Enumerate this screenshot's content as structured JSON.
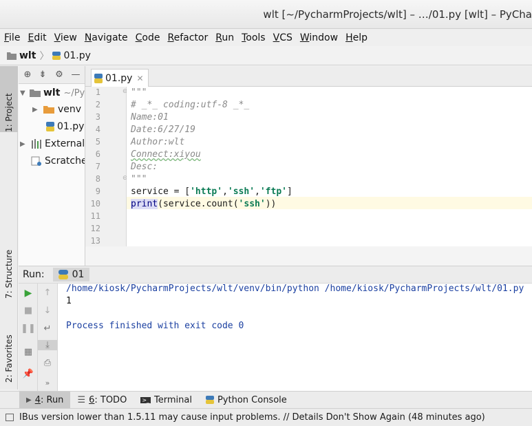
{
  "window": {
    "title": "wlt [~/PycharmProjects/wlt] – …/01.py [wlt] – PyCha"
  },
  "menu": [
    {
      "u": "F",
      "rest": "ile"
    },
    {
      "u": "E",
      "rest": "dit"
    },
    {
      "u": "V",
      "rest": "iew"
    },
    {
      "u": "N",
      "rest": "avigate"
    },
    {
      "u": "C",
      "rest": "ode"
    },
    {
      "u": "R",
      "rest": "efactor"
    },
    {
      "u": "R",
      "rest": "un"
    },
    {
      "u": "T",
      "rest": "ools"
    },
    {
      "u": "V",
      "rest": "CS"
    },
    {
      "u": "W",
      "rest": "indow"
    },
    {
      "u": "H",
      "rest": "elp"
    }
  ],
  "breadcrumb": {
    "project": "wlt",
    "file": "01.py"
  },
  "side_tabs": {
    "project": "1: Project",
    "structure": "7: Structure",
    "favorites": "2: Favorites"
  },
  "project_tree": {
    "root_name": "wlt",
    "root_path": "~/Py",
    "venv": "venv",
    "file": "01.py",
    "external": "External",
    "scratches": "Scratche"
  },
  "editor": {
    "tab_label": "01.py",
    "line_numbers": [
      "1",
      "2",
      "3",
      "4",
      "5",
      "6",
      "7",
      "8",
      "9",
      "10",
      "11",
      "12",
      "13"
    ],
    "lines": {
      "l1": "\"\"\"",
      "l2": "# _*_ coding:utf-8 _*_",
      "l3": "Name:01",
      "l4": "Date:6/27/19",
      "l5": "Author:wlt",
      "l6": "Connect:xiyou",
      "l7": "Desc:",
      "l8": "\"\"\"",
      "l9_a": "service = [",
      "l9_s1": "'http'",
      "l9_c1": ",",
      "l9_s2": "'ssh'",
      "l9_c2": ",",
      "l9_s3": "'ftp'",
      "l9_b": "]",
      "l10_kw": "print",
      "l10_a": "(service.count(",
      "l10_s": "'ssh'",
      "l10_b": "))"
    }
  },
  "run": {
    "label": "Run:",
    "config": "01",
    "output_cmd": "/home/kiosk/PycharmProjects/wlt/venv/bin/python /home/kiosk/PycharmProjects/wlt/01.py",
    "output_value": "1",
    "output_exit": "Process finished with exit code 0"
  },
  "bottom_tabs": [
    {
      "u": "4",
      "rest": ": Run"
    },
    {
      "u": "6",
      "rest": ": TODO"
    },
    {
      "u": "",
      "rest": "Terminal"
    },
    {
      "u": "",
      "rest": "Python Console"
    }
  ],
  "status": {
    "message": "IBus version lower than 1.5.11 may cause input problems. // Details Don't Show Again (48 minutes ago)"
  }
}
